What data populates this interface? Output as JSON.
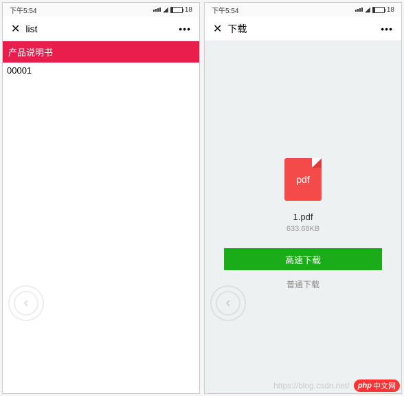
{
  "status": {
    "time": "下午5:54",
    "battery_pct": "18"
  },
  "left": {
    "nav_title": "list",
    "list_header": "产品说明书",
    "list_items": [
      "00001"
    ]
  },
  "right": {
    "nav_title": "下载",
    "file_icon_label": "pdf",
    "file_name": "1.pdf",
    "file_size": "633.68KB",
    "primary_btn": "高速下载",
    "secondary_link": "普通下载"
  },
  "watermark": {
    "url": "https://blog.csdn.net/",
    "badge_prefix": "php",
    "badge_text": "中文网"
  },
  "colors": {
    "accent_red": "#e91e4c",
    "pdf_red": "#f44a4a",
    "btn_green": "#1aad19"
  }
}
